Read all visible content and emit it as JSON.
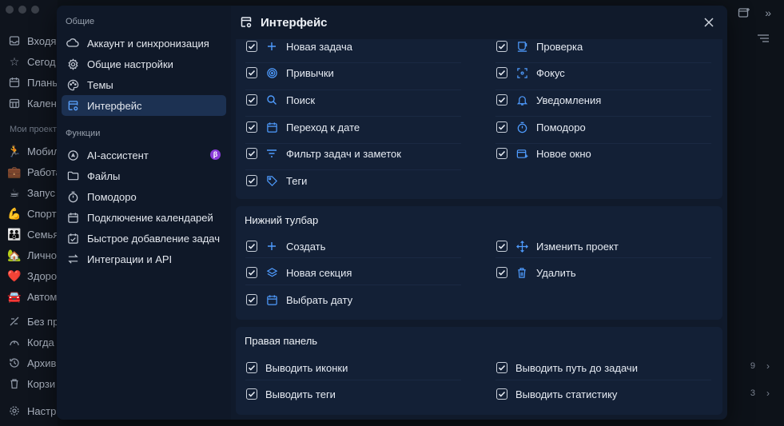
{
  "background": {
    "sidebar_items": [
      {
        "label": "Входя",
        "icon": "inbox-icon"
      },
      {
        "label": "Сегод",
        "icon": "star-icon"
      },
      {
        "label": "Плань",
        "icon": "calendar-icon"
      },
      {
        "label": "Кален",
        "icon": "calendar-grid-icon"
      }
    ],
    "projects_title": "Мои проекты",
    "project_items": [
      {
        "label": "Мобил",
        "emoji": "🏃"
      },
      {
        "label": "Работа",
        "emoji": "💼"
      },
      {
        "label": "Запус",
        "emoji": "☕"
      },
      {
        "label": "Спорт",
        "emoji": "💪"
      },
      {
        "label": "Семья",
        "emoji": "👪"
      },
      {
        "label": "Лично",
        "emoji": "🏡"
      },
      {
        "label": "Здоро",
        "emoji": "❤️"
      },
      {
        "label": "Автом",
        "emoji": "🚘"
      }
    ],
    "filter_items": [
      {
        "label": "Без пр",
        "icon": "no-project-icon"
      },
      {
        "label": "Когда",
        "icon": "someday-icon"
      },
      {
        "label": "Архив",
        "icon": "archive-icon"
      },
      {
        "label": "Корзи",
        "icon": "trash-icon"
      }
    ],
    "settings_label": "Настр",
    "counts": [
      "9",
      "3"
    ]
  },
  "modal": {
    "sidebar": {
      "general_title": "Общие",
      "general_items": [
        {
          "label": "Аккаунт и синхронизация",
          "icon": "cloud-icon"
        },
        {
          "label": "Общие настройки",
          "icon": "gear-icon"
        },
        {
          "label": "Темы",
          "icon": "palette-icon"
        },
        {
          "label": "Интерфейс",
          "icon": "interface-icon"
        }
      ],
      "functions_title": "Функции",
      "function_items": [
        {
          "label": "AI-ассистент",
          "icon": "ai-icon",
          "badge": "β"
        },
        {
          "label": "Файлы",
          "icon": "folder-icon"
        },
        {
          "label": "Помодоро",
          "icon": "timer-icon"
        },
        {
          "label": "Подключение календарей",
          "icon": "calendar-icon"
        },
        {
          "label": "Быстрое добавление задач",
          "icon": "quick-add-icon"
        },
        {
          "label": "Интеграции и API",
          "icon": "swap-icon"
        }
      ]
    },
    "header": {
      "title": "Интерфейс"
    },
    "top_section": {
      "left": [
        {
          "label": "Новая задача",
          "icon": "plus-icon",
          "checked": true
        },
        {
          "label": "Привычки",
          "icon": "habit-icon",
          "checked": true
        },
        {
          "label": "Поиск",
          "icon": "search-icon",
          "checked": true
        },
        {
          "label": "Переход к дате",
          "icon": "calendar-icon",
          "checked": true
        },
        {
          "label": "Фильтр задач и заметок",
          "icon": "filter-icon",
          "checked": true
        },
        {
          "label": "Теги",
          "icon": "tag-icon",
          "checked": true
        }
      ],
      "right": [
        {
          "label": "Проверка",
          "icon": "cup-icon",
          "checked": true
        },
        {
          "label": "Фокус",
          "icon": "focus-icon",
          "checked": true
        },
        {
          "label": "Уведомления",
          "icon": "bell-icon",
          "checked": true
        },
        {
          "label": "Помодоро",
          "icon": "timer-icon",
          "checked": true
        },
        {
          "label": "Новое окно",
          "icon": "new-window-icon",
          "checked": true
        }
      ]
    },
    "bottom_toolbar": {
      "title": "Нижний тулбар",
      "left": [
        {
          "label": "Создать",
          "icon": "plus-icon",
          "checked": true
        },
        {
          "label": "Новая секция",
          "icon": "layers-icon",
          "checked": true
        },
        {
          "label": "Выбрать дату",
          "icon": "calendar-icon",
          "checked": true
        }
      ],
      "right": [
        {
          "label": "Изменить проект",
          "icon": "move-icon",
          "checked": true
        },
        {
          "label": "Удалить",
          "icon": "trash-icon",
          "checked": true
        }
      ]
    },
    "right_panel": {
      "title": "Правая панель",
      "left": [
        {
          "label": "Выводить иконки",
          "checked": true
        },
        {
          "label": "Выводить теги",
          "checked": true
        }
      ],
      "right": [
        {
          "label": "Выводить путь до задачи",
          "checked": true
        },
        {
          "label": "Выводить статистику",
          "checked": true
        }
      ]
    }
  }
}
